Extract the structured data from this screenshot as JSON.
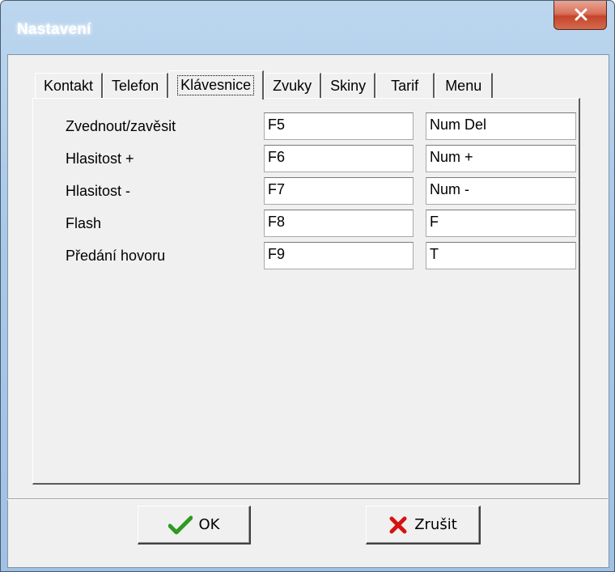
{
  "window": {
    "title": "Nastavení"
  },
  "tabs": [
    {
      "label": "Kontakt",
      "active": false
    },
    {
      "label": "Telefon",
      "active": false
    },
    {
      "label": "Klávesnice",
      "active": true
    },
    {
      "label": "Zvuky",
      "active": false
    },
    {
      "label": "Skiny",
      "active": false
    },
    {
      "label": "Tarif",
      "active": false
    },
    {
      "label": "Menu",
      "active": false
    }
  ],
  "shortcuts": [
    {
      "label": "Zvednout/zavěsit",
      "key1": "F5",
      "key2": "Num Del"
    },
    {
      "label": "Hlasitost +",
      "key1": "F6",
      "key2": "Num +"
    },
    {
      "label": "Hlasitost -",
      "key1": "F7",
      "key2": "Num -"
    },
    {
      "label": "Flash",
      "key1": "F8",
      "key2": "F"
    },
    {
      "label": "Předání hovoru",
      "key1": "F9",
      "key2": "T"
    }
  ],
  "buttons": {
    "ok_label": "OK",
    "cancel_label": "Zrušit"
  },
  "icons": {
    "close": "close-icon",
    "ok": "checkmark-icon",
    "cancel": "red-x-icon"
  },
  "colors": {
    "check_green": "#2e9a1f",
    "cancel_red": "#d4140f",
    "close_red": "#c4452c"
  }
}
